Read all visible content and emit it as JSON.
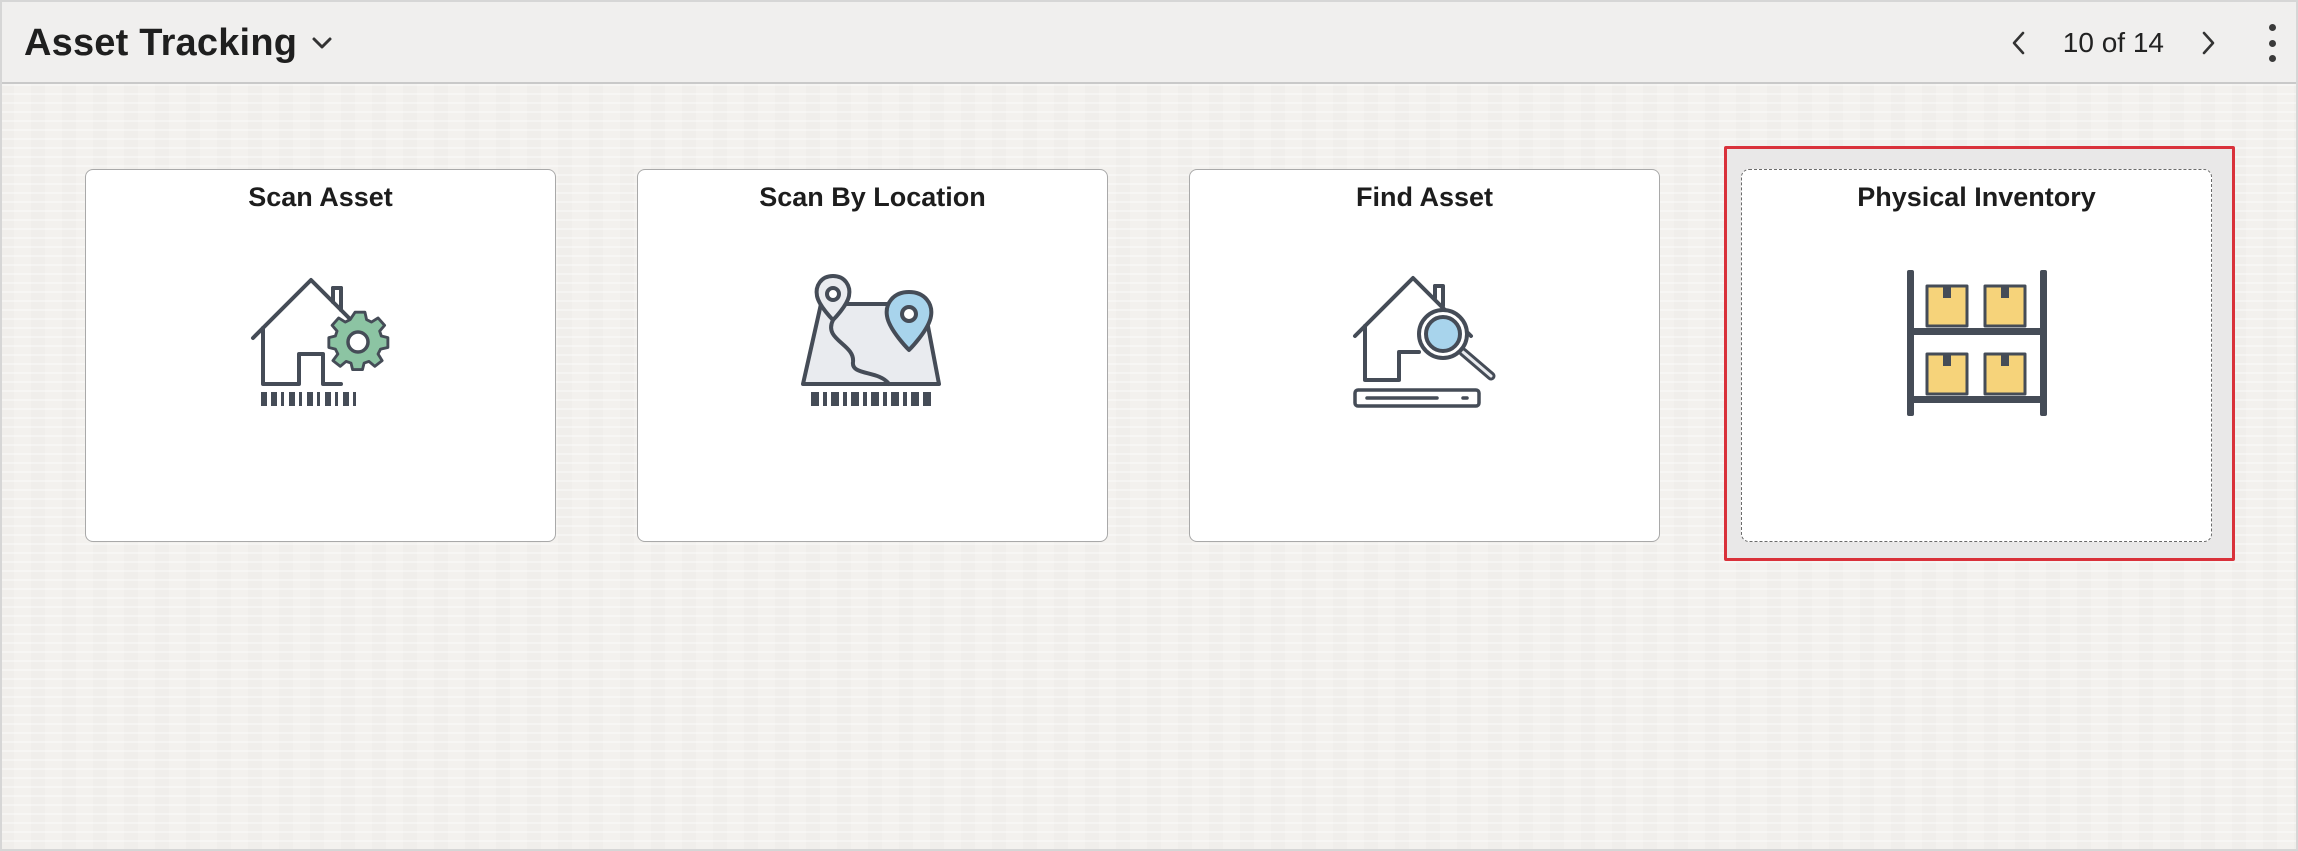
{
  "header": {
    "title": "Asset Tracking",
    "pager_text": "10 of 14"
  },
  "tiles": [
    {
      "title": "Scan Asset",
      "icon": "house-gear-barcode-icon"
    },
    {
      "title": "Scan By Location",
      "icon": "map-pin-barcode-icon"
    },
    {
      "title": "Find Asset",
      "icon": "house-magnifier-icon"
    },
    {
      "title": "Physical Inventory",
      "icon": "shelf-boxes-icon"
    }
  ],
  "colors": {
    "accent_green": "#8cc4a3",
    "accent_blue": "#a8d4ec",
    "box_yellow": "#f6d37a",
    "outline": "#454c57",
    "highlight": "#d9313a"
  }
}
